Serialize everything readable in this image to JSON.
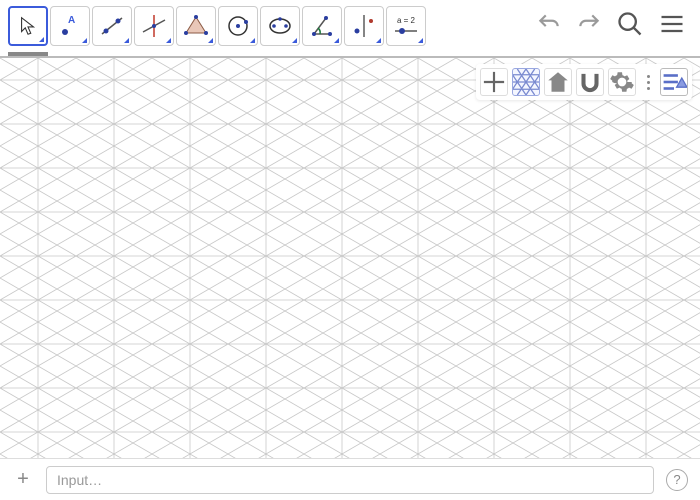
{
  "tools": [
    {
      "name": "move-tool",
      "icon": "pointer",
      "selected": true
    },
    {
      "name": "point-tool",
      "icon": "point",
      "selected": false
    },
    {
      "name": "line-tool",
      "icon": "line",
      "selected": false
    },
    {
      "name": "perpendicular-tool",
      "icon": "perp",
      "selected": false
    },
    {
      "name": "polygon-tool",
      "icon": "polygon",
      "selected": false
    },
    {
      "name": "circle-tool",
      "icon": "circle",
      "selected": false
    },
    {
      "name": "ellipse-tool",
      "icon": "ellipse",
      "selected": false
    },
    {
      "name": "angle-tool",
      "icon": "angle",
      "selected": false
    },
    {
      "name": "reflect-tool",
      "icon": "reflect",
      "selected": false
    },
    {
      "name": "slider-tool",
      "icon": "slider",
      "label": "a = 2",
      "selected": false
    }
  ],
  "header_icons": {
    "undo": "undo-icon",
    "redo": "redo-icon",
    "search": "search-icon",
    "menu": "menu-icon"
  },
  "view_toolbar": {
    "axes": "axes-icon",
    "grid": "isogrid-icon",
    "home": "home-icon",
    "snap": "snap-icon",
    "settings": "gear-icon",
    "more": "vdots-icon",
    "props": "properties-icon"
  },
  "grid": {
    "type": "isometric",
    "spacing": 38
  },
  "inputbar": {
    "add": "+",
    "placeholder": "Input…",
    "value": "",
    "help": "?"
  },
  "colors": {
    "accent": "#3b5bdb",
    "gridline": "#c8c8c8",
    "icon": "#6b6b6b"
  }
}
